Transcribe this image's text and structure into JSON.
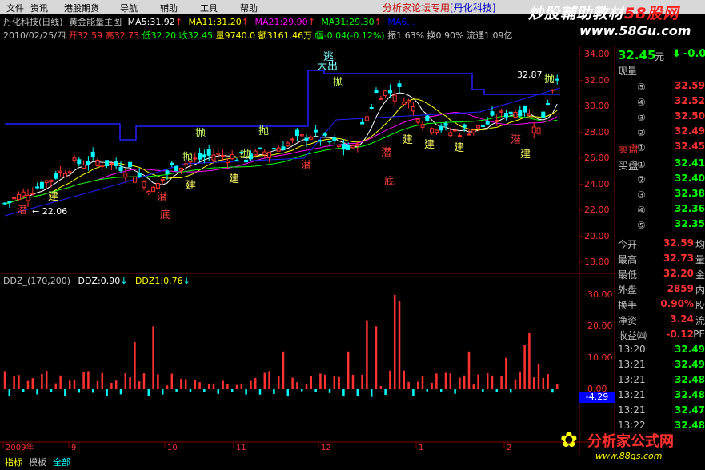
{
  "menu": {
    "items": [
      "文件",
      "资讯",
      "港股期货",
      "导航",
      "辅助",
      "工具",
      "帮助"
    ],
    "ad_prefix": "分析家论坛专用",
    "ad_suffix": "[丹化科技]"
  },
  "watermark": {
    "logo_a": "炒股輔助教材",
    "logo_b": "58股网",
    "url_a": "www.58Gu.com",
    "logo2": "分析家公式网",
    "url2": "www.88gs.com"
  },
  "chart_title_line": {
    "name": "丹化科技(日线)",
    "indicator": "黄金能量主图",
    "ma5": "MA5:31.92",
    "ma11": "MA11:31.20",
    "ma21": "MA21:29.90",
    "ma31": "MA31:29.30",
    "ma_extra": "MA6...",
    "ma_extra2": "MA..."
  },
  "info_line": {
    "date": "2010/02/25/四",
    "open": "开32.59",
    "high": "高32.73",
    "low": "低32.20",
    "close": "收32.45",
    "vol": "量9740.0",
    "amt": "额3161.46万",
    "chg": "幅-0.04(-0.12%)",
    "amp": "振1.63%",
    "turn": "换0.90%",
    "float": "流通1.09亿"
  },
  "price_axis": [
    "34.00",
    "32.00",
    "30.00",
    "28.00",
    "26.00",
    "24.00",
    "22.00",
    "20.00",
    "18.00"
  ],
  "sub_axis": [
    "30.00",
    "20.00",
    "10.00",
    "0.00"
  ],
  "sub_current": "-4.29",
  "sub_title": {
    "name": "DDZ_(170,200)",
    "ddz": "DDZ:0.90",
    "ddz1": "DDZ1:0.76"
  },
  "annotations": {
    "low_label": "22.06",
    "high_label": "32.87",
    "big_exit": "大出",
    "escape": "逃",
    "jian": "建",
    "pao": "抛",
    "qian": "潜",
    "di": "底",
    "zhang": "涨"
  },
  "time_axis": [
    "2009年",
    "9",
    "10",
    "11",
    "12",
    "1",
    "2"
  ],
  "side": {
    "current": "32.45",
    "unit": "元",
    "change": "-0.0",
    "xianliang": "现量",
    "sell_levels": [
      {
        "n": "⑤",
        "p": "32.59"
      },
      {
        "n": "④",
        "p": "32.52"
      },
      {
        "n": "③",
        "p": "32.50"
      },
      {
        "n": "②",
        "p": "32.49"
      },
      {
        "n": "①",
        "p": "32.45"
      }
    ],
    "sell_label": "卖盘",
    "buy_label": "买盘",
    "buy_levels": [
      {
        "n": "①",
        "p": "32.41"
      },
      {
        "n": "②",
        "p": "32.40"
      },
      {
        "n": "③",
        "p": "32.38"
      },
      {
        "n": "④",
        "p": "32.36"
      },
      {
        "n": "⑤",
        "p": "32.35"
      }
    ],
    "stats": [
      {
        "l": "今开",
        "v": "32.59",
        "r": "均"
      },
      {
        "l": "最高",
        "v": "32.73",
        "r": "量"
      },
      {
        "l": "最低",
        "v": "32.20",
        "r": "金"
      },
      {
        "l": "外盘",
        "v": "2859",
        "r": "内"
      },
      {
        "l": "换手",
        "v": "0.90%",
        "r": "股"
      },
      {
        "l": "净资",
        "v": "3.24",
        "r": "流"
      },
      {
        "l": "收益㈣",
        "v": "-0.12",
        "r": "PE"
      }
    ],
    "ticks": [
      {
        "t": "13:20",
        "p": "32.49"
      },
      {
        "t": "13:21",
        "p": "32.49"
      },
      {
        "t": "13:21",
        "p": "32.48"
      },
      {
        "t": "13:21",
        "p": "32.48"
      },
      {
        "t": "13:21",
        "p": "32.47"
      },
      {
        "t": "13:22",
        "p": "32.48"
      }
    ]
  },
  "bottom_tabs": [
    "指标",
    "模板",
    "全部"
  ],
  "colors": {
    "up": "#ff3232",
    "down": "#00ffff",
    "ma5": "#ffffff",
    "ma11": "#ffff00",
    "ma21": "#ff00ff",
    "ma31": "#00ff00",
    "ma60": "#0000ff"
  }
}
